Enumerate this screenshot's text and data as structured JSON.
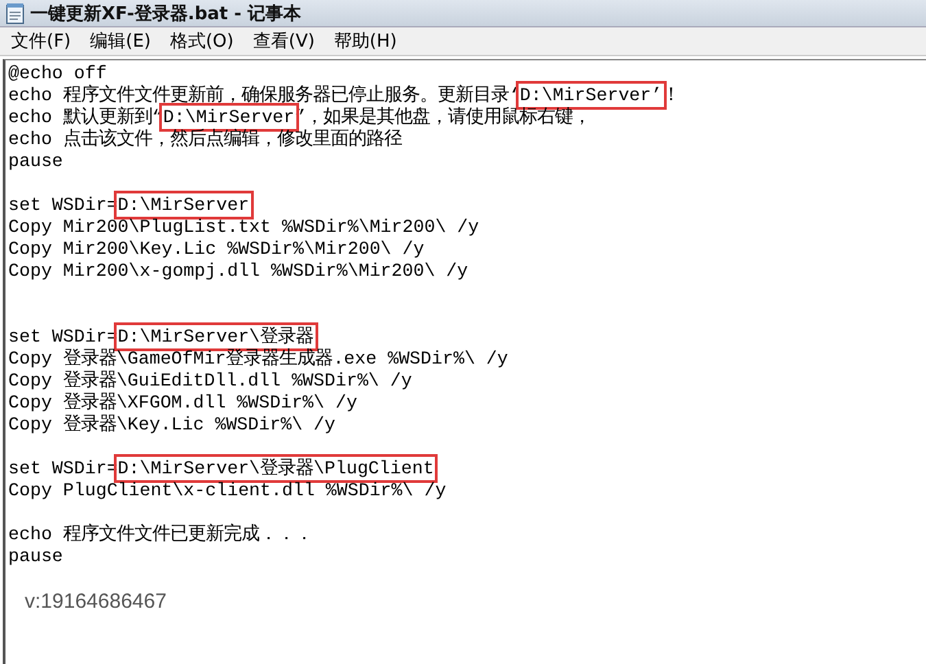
{
  "window": {
    "title": "一键更新XF-登录器.bat - 记事本"
  },
  "menu": [
    {
      "label": "文件(F)"
    },
    {
      "label": "编辑(E)"
    },
    {
      "label": "格式(O)"
    },
    {
      "label": "查看(V)"
    },
    {
      "label": "帮助(H)"
    }
  ],
  "editor": {
    "lines": [
      {
        "kind": "text",
        "segments": [
          {
            "text": "@echo off",
            "highlighted": false
          }
        ]
      },
      {
        "kind": "text",
        "segments": [
          {
            "text": "echo 程序文件文件更新前，确保服务器已停止服务。更新目录‘",
            "highlighted": false
          },
          {
            "text": "D:\\MirServer’",
            "highlighted": true
          },
          {
            "text": "！",
            "highlighted": false
          }
        ]
      },
      {
        "kind": "text",
        "segments": [
          {
            "text": "echo 默认更新到“",
            "highlighted": false
          },
          {
            "text": "D:\\MirServer",
            "highlighted": true
          },
          {
            "text": "”，如果是其他盘，请使用鼠标右键，",
            "highlighted": false
          }
        ]
      },
      {
        "kind": "text",
        "segments": [
          {
            "text": "echo 点击该文件，然后点编辑，修改里面的路径",
            "highlighted": false
          }
        ]
      },
      {
        "kind": "text",
        "segments": [
          {
            "text": "pause",
            "highlighted": false
          }
        ]
      },
      {
        "kind": "blank"
      },
      {
        "kind": "text",
        "segments": [
          {
            "text": "set WSDir=",
            "highlighted": false
          },
          {
            "text": "D:\\MirServer",
            "highlighted": true
          }
        ]
      },
      {
        "kind": "text",
        "segments": [
          {
            "text": "Copy Mir200\\PlugList.txt %WSDir%\\Mir200\\ /y",
            "highlighted": false
          }
        ]
      },
      {
        "kind": "text",
        "segments": [
          {
            "text": "Copy Mir200\\Key.Lic %WSDir%\\Mir200\\ /y",
            "highlighted": false
          }
        ]
      },
      {
        "kind": "text",
        "segments": [
          {
            "text": "Copy Mir200\\x-gompj.dll %WSDir%\\Mir200\\ /y",
            "highlighted": false
          }
        ]
      },
      {
        "kind": "blank"
      },
      {
        "kind": "blank"
      },
      {
        "kind": "text",
        "segments": [
          {
            "text": "set WSDir=",
            "highlighted": false
          },
          {
            "text": "D:\\MirServer\\登录器",
            "highlighted": true
          }
        ]
      },
      {
        "kind": "text",
        "segments": [
          {
            "text": "Copy 登录器\\GameOfMir登录器生成器.exe %WSDir%\\ /y",
            "highlighted": false
          }
        ]
      },
      {
        "kind": "text",
        "segments": [
          {
            "text": "Copy 登录器\\GuiEditDll.dll %WSDir%\\ /y",
            "highlighted": false
          }
        ]
      },
      {
        "kind": "text",
        "segments": [
          {
            "text": "Copy 登录器\\XFGOM.dll %WSDir%\\ /y",
            "highlighted": false
          }
        ]
      },
      {
        "kind": "text",
        "segments": [
          {
            "text": "Copy 登录器\\Key.Lic %WSDir%\\ /y",
            "highlighted": false
          }
        ]
      },
      {
        "kind": "blank"
      },
      {
        "kind": "text",
        "segments": [
          {
            "text": "set WSDir=",
            "highlighted": false
          },
          {
            "text": "D:\\MirServer\\登录器\\PlugClient",
            "highlighted": true
          }
        ]
      },
      {
        "kind": "text",
        "segments": [
          {
            "text": "Copy PlugClient\\x-client.dll %WSDir%\\ /y",
            "highlighted": false
          }
        ]
      },
      {
        "kind": "blank"
      },
      {
        "kind": "text",
        "segments": [
          {
            "text": "echo 程序文件文件已更新完成．．．",
            "highlighted": false
          }
        ]
      },
      {
        "kind": "text",
        "segments": [
          {
            "text": "pause",
            "highlighted": false
          }
        ]
      }
    ]
  },
  "caption": "v:19164686467"
}
